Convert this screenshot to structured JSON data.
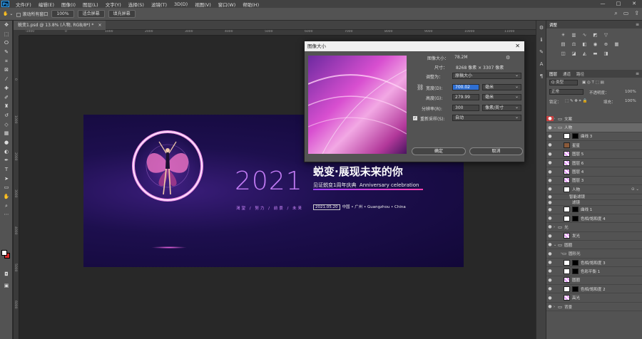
{
  "app": {
    "logo": "Ps"
  },
  "menu": [
    "文件(F)",
    "编辑(E)",
    "图像(I)",
    "图层(L)",
    "文字(Y)",
    "选择(S)",
    "滤镜(T)",
    "3D(D)",
    "视图(V)",
    "窗口(W)",
    "帮助(H)"
  ],
  "window_controls": {
    "minimize": "—",
    "maximize": "□",
    "close": "✕"
  },
  "options": {
    "scroll_all_label": "滚动所有窗口",
    "zoom_100": "100%",
    "fit_screen": "适合屏幕",
    "fill_screen": "填充屏幕"
  },
  "document_tab": {
    "title": "蜕变1.psd @ 13.8% (人物, RGB/8*) *",
    "close": "×"
  },
  "ruler_top": [
    "-1000",
    "0",
    "1000",
    "2000",
    "3000",
    "4000",
    "5000",
    "6000",
    "7000",
    "8000",
    "9000",
    "10000",
    "11000"
  ],
  "ruler_left": [
    "0",
    "1000",
    "2000",
    "3000",
    "4000",
    "5000",
    "6000",
    "7000"
  ],
  "banner": {
    "year": "2021",
    "headline": "蜕变·展现未来的你",
    "subline_cn": "见证蜕变1周年庆典",
    "subline_en": "Anniversary celebration",
    "keywords": "渴望 / 努力 / 前景 / 未来",
    "event_date": "2021.05.20",
    "event_location": "中国 • 广州 • Guangzhou • China"
  },
  "dialog": {
    "title": "图像大小",
    "close": "✕",
    "image_size_label": "图像大小：",
    "image_size_value": "78.2M",
    "dimensions_label": "尺寸：",
    "dimensions_value": "8268 像素 × 3307 像素",
    "fit_to_label": "调整为：",
    "fit_to_value": "原稿大小",
    "width_label": "宽度(D):",
    "width_value": "700.02",
    "width_unit": "毫米",
    "height_label": "高度(G):",
    "height_value": "279.99",
    "height_unit": "毫米",
    "resolution_label": "分辨率(R):",
    "resolution_value": "300",
    "resolution_unit": "像素/英寸",
    "resample_label": "重新采样(S):",
    "resample_value": "自动",
    "ok": "确定",
    "cancel": "取消"
  },
  "adjustments": {
    "title": "调整"
  },
  "layers_panel": {
    "tabs": [
      "图层",
      "通道",
      "路径"
    ],
    "kind_label": "Q 类型",
    "blend_mode": "正常",
    "opacity_label": "不透明度：",
    "opacity_value": "100%",
    "lock_label": "锁定：",
    "fill_label": "填充：",
    "fill_value": "100%",
    "layers": [
      {
        "name": "文案",
        "type": "group"
      },
      {
        "name": "人物",
        "type": "group"
      },
      {
        "name": "曲线 3",
        "type": "adj"
      },
      {
        "name": "星星",
        "type": "photo"
      },
      {
        "name": "图层 5",
        "type": "pink"
      },
      {
        "name": "图层 6",
        "type": "pink"
      },
      {
        "name": "图层 4",
        "type": "pink"
      },
      {
        "name": "图层 3",
        "type": "pink"
      },
      {
        "name": "人物",
        "type": "smart"
      },
      {
        "name": "智能滤镜",
        "type": "sub"
      },
      {
        "name": "滤镜",
        "type": "sub"
      },
      {
        "name": "曲线 1",
        "type": "adj"
      },
      {
        "name": "色相/饱和度 4",
        "type": "adj"
      },
      {
        "name": "光",
        "type": "group"
      },
      {
        "name": "发光",
        "type": "pink"
      },
      {
        "name": "圆圈",
        "type": "group"
      },
      {
        "name": "圆形光",
        "type": "group"
      },
      {
        "name": "色相/饱和度 3",
        "type": "adj"
      },
      {
        "name": "色彩平衡 1",
        "type": "adj"
      },
      {
        "name": "圆圈",
        "type": "pink"
      },
      {
        "name": "色相/饱和度 2",
        "type": "adj"
      },
      {
        "name": "高光",
        "type": "pink"
      },
      {
        "name": "背景",
        "type": "group"
      }
    ]
  }
}
